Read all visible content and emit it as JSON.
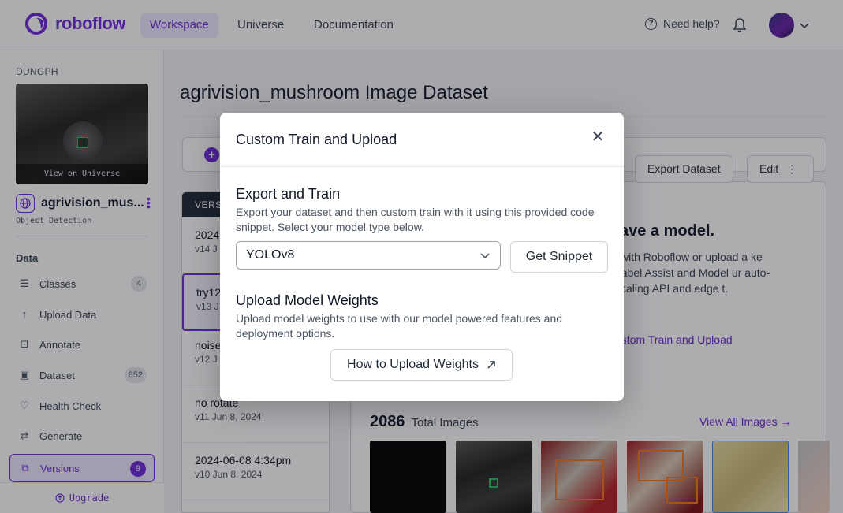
{
  "app": {
    "brand": "roboflow",
    "accent_color": "#6d28d9"
  },
  "nav": {
    "tabs": [
      {
        "label": "Workspace",
        "active": true
      },
      {
        "label": "Universe",
        "active": false
      },
      {
        "label": "Documentation",
        "active": false
      }
    ],
    "help_label": "Need help?",
    "help_icon": "question-circle-icon",
    "bell_icon": "bell-icon"
  },
  "sidebar": {
    "workspace_name": "DUNGPH",
    "thumbnail_caption": "View on Universe",
    "project_name": "agrivision_mus...",
    "project_type": "Object Detection",
    "section_label": "Data",
    "items": [
      {
        "label": "Classes",
        "icon": "list-icon",
        "count": "4",
        "active": false
      },
      {
        "label": "Upload Data",
        "icon": "upload-arrow-icon",
        "count": null,
        "active": false
      },
      {
        "label": "Annotate",
        "icon": "annotate-icon",
        "count": null,
        "active": false
      },
      {
        "label": "Dataset",
        "icon": "images-icon",
        "count": "852",
        "active": false
      },
      {
        "label": "Health Check",
        "icon": "heart-pulse-icon",
        "count": null,
        "active": false
      },
      {
        "label": "Generate",
        "icon": "generate-icon",
        "count": null,
        "active": false
      },
      {
        "label": "Versions",
        "icon": "versions-icon",
        "count": "9",
        "active": true
      }
    ],
    "upgrade_label": "Upgrade"
  },
  "main": {
    "title": "agrivision_mushroom Image Dataset",
    "export_button": "Export Dataset",
    "edit_button": "Edit",
    "versions_header": "VERS",
    "versions": [
      {
        "name": "2024",
        "sub": "v14 J",
        "selected": false
      },
      {
        "name": "try12",
        "sub": "v13 J",
        "selected": true
      },
      {
        "name": "noise",
        "sub": "v12 J",
        "selected": false
      },
      {
        "name": "no rotate",
        "sub": "v11 Jun 8, 2024",
        "selected": false
      },
      {
        "name": "2024-06-08 4:34pm",
        "sub": "v10 Jun 8, 2024",
        "selected": false
      }
    ],
    "model_heading": "ave a model.",
    "model_desc": "l with Roboflow or upload a ke Label Assist and Model ur auto-scaling API and edge t.",
    "model_link": "ustom Train and Upload",
    "image_count": "2086",
    "image_count_label": "Total Images",
    "view_all_label": "View All Images"
  },
  "modal": {
    "title": "Custom Train and Upload",
    "export_heading": "Export and Train",
    "export_desc": "Export your dataset and then custom train with it using this provided code snippet. Select your model type below.",
    "model_select_value": "YOLOv8",
    "snippet_button": "Get Snippet",
    "upload_heading": "Upload Model Weights",
    "upload_desc": "Upload model weights to use with our model powered features and deployment options.",
    "howto_button": "How to Upload Weights"
  }
}
